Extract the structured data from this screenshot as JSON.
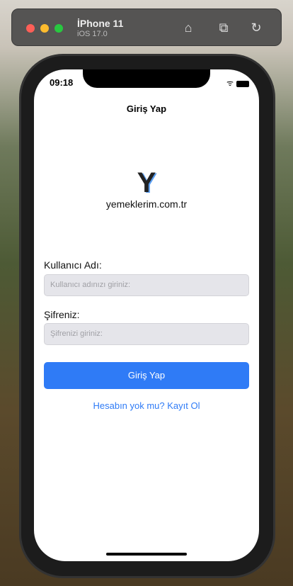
{
  "simulator": {
    "device": "İPhone 11",
    "os": "iOS 17.0",
    "icons": [
      "home-icon",
      "screenshot-icon",
      "rotate-icon"
    ]
  },
  "status_bar": {
    "time": "09:18"
  },
  "nav": {
    "title": "Giriş Yap"
  },
  "logo": {
    "letter": "Y",
    "text": "yemeklerim.com.tr"
  },
  "form": {
    "username_label": "Kullanıcı Adı:",
    "username_placeholder": "Kullanıcı adınızı giriniz:",
    "password_label": "Şifreniz:",
    "password_placeholder": "Şifrenizi giriniz:",
    "login_button": "Giriş Yap",
    "register_link": "Hesabın yok mu? Kayıt Ol"
  },
  "colors": {
    "accent": "#2f7bf6"
  }
}
